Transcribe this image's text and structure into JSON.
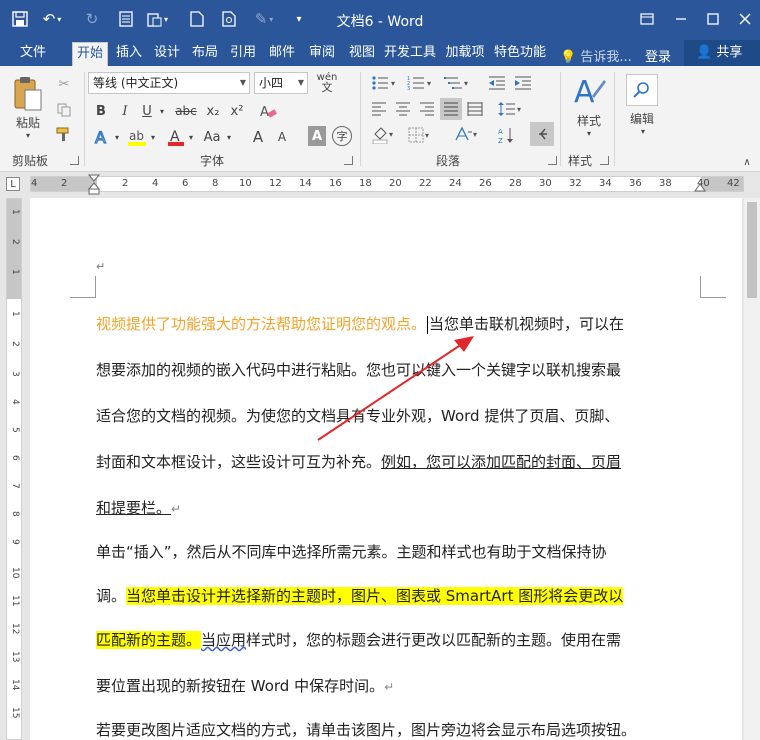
{
  "window": {
    "title": "文档6 - Word"
  },
  "tabs": [
    "文件",
    "开始",
    "插入",
    "设计",
    "布局",
    "引用",
    "邮件",
    "审阅",
    "视图",
    "开发工具",
    "加载项",
    "特色功能"
  ],
  "header": {
    "tell_me": "告诉我...",
    "login": "登录",
    "share": "共享"
  },
  "ribbon": {
    "paste_label": "粘贴",
    "font_name": "等线 (中文正文)",
    "font_size": "小四",
    "wen_label": "wén",
    "bold": "B",
    "italic": "I",
    "underline": "U",
    "strike": "abc",
    "subscript": "x₂",
    "superscript": "x²",
    "font_A": "A",
    "aa_label": "Aa",
    "grow_font": "A",
    "shrink_font": "A",
    "char_shading": "A",
    "enclose": "字",
    "styles_label": "样式",
    "editing_label": "编辑",
    "groups": {
      "clipboard": "剪贴板",
      "font": "字体",
      "paragraph": "段落",
      "styles": "样式"
    }
  },
  "ruler": {
    "numbers": [
      "4",
      "2",
      "",
      "2",
      "4",
      "6",
      "8",
      "10",
      "12",
      "14",
      "16",
      "18",
      "20",
      "22",
      "24",
      "26",
      "28",
      "30",
      "32",
      "34",
      "36",
      "38",
      "40",
      "42"
    ],
    "vnumbers": [
      "1",
      "2",
      "1",
      "1",
      "2",
      "3",
      "4",
      "5",
      "6",
      "7",
      "8",
      "9",
      "10",
      "11",
      "12",
      "13",
      "14",
      "15",
      "16",
      "17",
      "18"
    ]
  },
  "doc": {
    "l1a": "视频提供了功能强大的方法帮助您证明您的观点。",
    "l1b": "当您单击联机视频时，可以在",
    "l2": "想要添加的视频的嵌入代码中进行粘贴。您也可以键入一个关键字以联机搜索最",
    "l3": "适合您的文档的视频。为使您的文档具有专业外观，Word 提供了页眉、页脚、",
    "l4a": "封面和文本框设计，这些设计可互为补充。",
    "l4b": "例如，您可以添加匹配的封面、页眉",
    "l5": "和提要栏。",
    "l6": "单击“插入”，然后从不同库中选择所需元素。主题和样式也有助于文档保持协",
    "l7a": "调。",
    "l7b": "当您单击设计并选择新的主题时，图片、图表或 SmartArt 图形将会更改以",
    "l8a": "匹配新的主题。",
    "l8b_sq": "当应用",
    "l8c": "样式时，您的标题会进行更改以匹配新的主题。使用在需",
    "l9": "要位置出现的新按钮在 Word 中保存时间。",
    "l10": "若要更改图片适应文档的方式，请单击该图片，图片旁边将会显示布局选项按钮。"
  },
  "colors": {
    "brand": "#2b579a",
    "highlight": "#ffff00",
    "orange_text": "#f4a32a",
    "arrow": "#e0282c"
  }
}
